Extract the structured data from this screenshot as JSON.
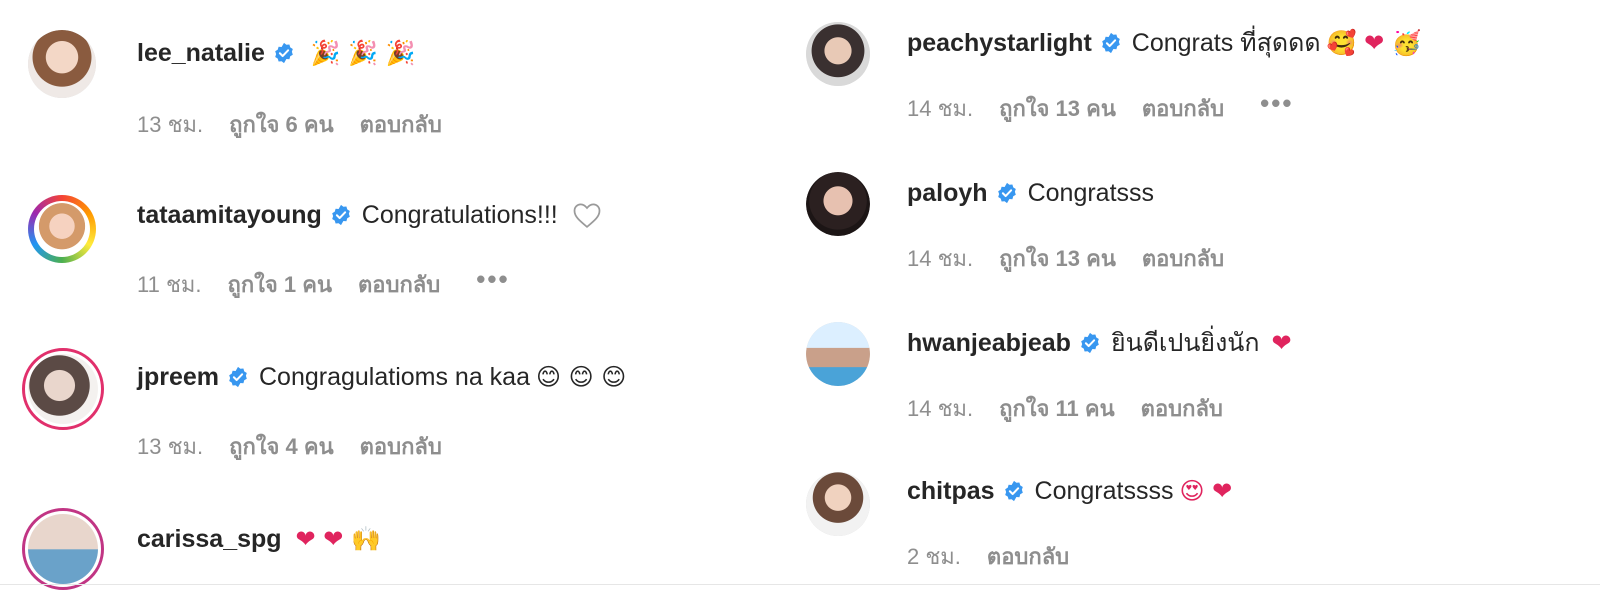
{
  "colors": {
    "verified": "#3897f0",
    "meta": "#8e8e8e",
    "text": "#262626",
    "ring": "#d6249f"
  },
  "left": [
    {
      "username": "lee_natalie",
      "text": "",
      "emoji": "🎉 🎉 🎉",
      "time": "13 ชม.",
      "likes": "ถูกใจ 6 คน",
      "reply": "ตอบกลับ",
      "more": "",
      "avatar": "avatar-lee_natalie"
    },
    {
      "username": "tataamitayoung",
      "text": "Congratulations!!!",
      "emoji": "",
      "time": "11 ชม.",
      "likes": "ถูกใจ 1 คน",
      "reply": "ตอบกลับ",
      "more": "•••",
      "avatar": "avatar-tataamitayoung",
      "like_icon": "heart-outline-icon"
    },
    {
      "username": "jpreem",
      "text": "Congragulatioms na kaa",
      "emoji": "😊 😊 😊",
      "time": "13 ชม.",
      "likes": "ถูกใจ 4 คน",
      "reply": "ตอบกลับ",
      "more": "",
      "avatar": "avatar-jpreem"
    },
    {
      "username": "carissa_spg",
      "text": "",
      "emoji": "❤ ❤ 🙌",
      "time": "",
      "likes": "",
      "reply": "",
      "more": "",
      "avatar": "avatar-carissa_spg"
    }
  ],
  "right": [
    {
      "username": "peachystarlight",
      "text": "Congrats ที่สุดดด",
      "emoji": "🥰 ❤ 🥳",
      "time": "14 ชม.",
      "likes": "ถูกใจ 13 คน",
      "reply": "ตอบกลับ",
      "more": "•••",
      "avatar": "avatar-peachystarlight"
    },
    {
      "username": "paloyh",
      "text": "Congratsss",
      "emoji": "",
      "time": "14 ชม.",
      "likes": "ถูกใจ 13 คน",
      "reply": "ตอบกลับ",
      "more": "",
      "avatar": "avatar-paloyh"
    },
    {
      "username": "hwanjeabjeab",
      "text": "ยินดีเปนยิ่งนัก",
      "emoji": "❤",
      "time": "14 ชม.",
      "likes": "ถูกใจ 11 คน",
      "reply": "ตอบกลับ",
      "more": "",
      "avatar": "avatar-hwanjeabjeab"
    },
    {
      "username": "chitpas",
      "text": "Congratssss",
      "emoji": "😍 ❤",
      "time": "2 ชม.",
      "likes": "",
      "reply": "ตอบกลับ",
      "more": "",
      "avatar": "avatar-chitpas"
    }
  ]
}
